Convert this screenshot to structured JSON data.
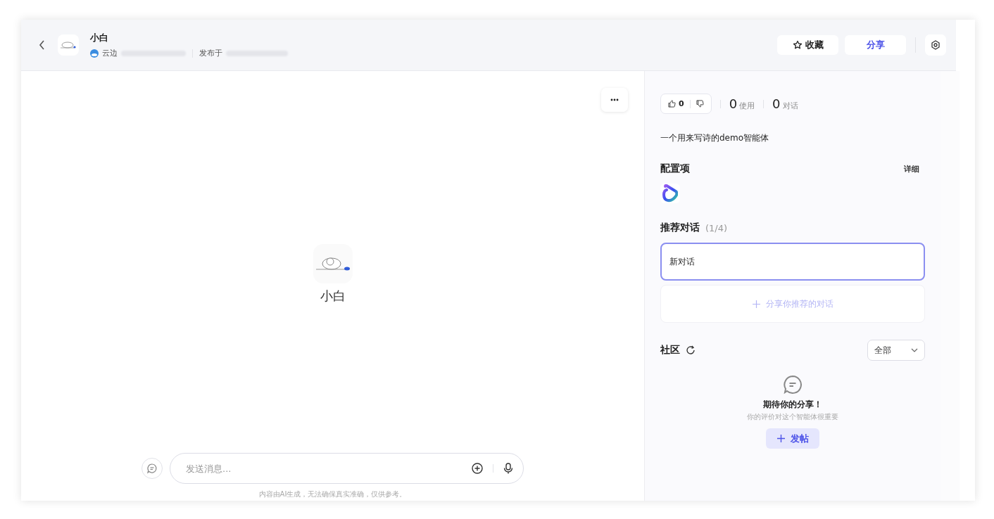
{
  "header": {
    "title": "小白",
    "author": "云边",
    "published_label": "发布于",
    "favorite_button": "收藏",
    "share_button": "分享"
  },
  "chat": {
    "bot_name": "小白",
    "input": {
      "placeholder": "发送消息..."
    },
    "disclaimer": "内容由AI生成，无法确保真实准确，仅供参考。"
  },
  "panel": {
    "likes": "0",
    "stats": [
      {
        "value": "0",
        "label": "使用"
      },
      {
        "value": "0",
        "label": "对话"
      }
    ],
    "description": "一个用来写诗的demo智能体",
    "config": {
      "title": "配置项",
      "detail_link": "详细"
    },
    "recommended": {
      "title": "推荐对话",
      "count": "(1/4)",
      "items": [
        {
          "text": "新对话",
          "selected": true
        }
      ],
      "add_label": "分享你推荐的对话"
    },
    "community": {
      "title": "社区",
      "filter": "全部",
      "empty_title": "期待你的分享！",
      "empty_hint": "你的评价对这个智能体很重要",
      "post_button": "发帖"
    }
  }
}
